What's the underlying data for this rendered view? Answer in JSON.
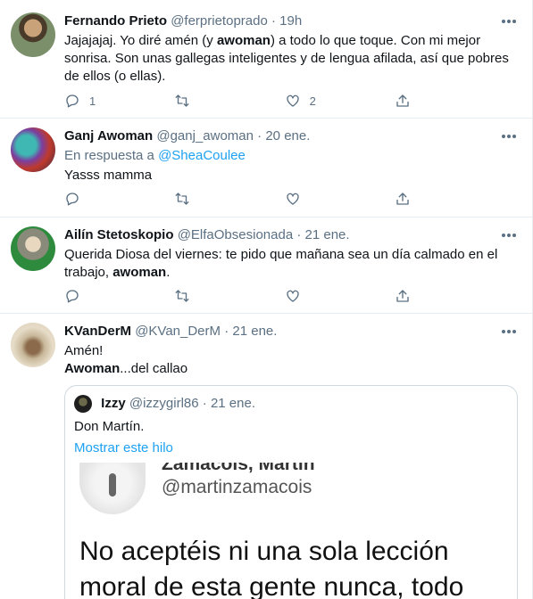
{
  "tweets": [
    {
      "name": "Fernando Prieto",
      "handle": "@ferprietoprado",
      "time": "19h",
      "text_parts": [
        "Jajajajaj. Yo diré amén (y ",
        "awoman",
        ") a todo lo que toque. Con mi mejor sonrisa. Son unas gallegas inteligentes y de lengua afilada, así que pobres de ellos (o ellas)."
      ],
      "reply_count": "1",
      "like_count": "2"
    },
    {
      "name": "Ganj Awoman",
      "handle": "@ganj_awoman",
      "time": "20 ene.",
      "reply_prefix": "En respuesta a",
      "reply_handle": "@SheaCoulee",
      "text": "Yasss mamma"
    },
    {
      "name": "Ailín Stetoskopio",
      "handle": "@ElfaObsesionada",
      "time": "21 ene.",
      "text_parts": [
        "Querida Diosa del viernes: te pido que mañana sea un día calmado en el trabajo, ",
        "awoman",
        "."
      ]
    },
    {
      "name": "KVanDerM",
      "handle": "@KVan_DerM",
      "time": "21 ene.",
      "line1": "Amén!",
      "line2_bold": "Awoman",
      "line2_rest": "...del callao",
      "quote": {
        "name": "Izzy",
        "handle": "@izzygirl86",
        "time": "21 ene.",
        "text": "Don Martín.",
        "link": "Mostrar este hilo",
        "image": {
          "name": "Zamacois, Martín",
          "handle": "@martinzamacois",
          "line1": "No aceptéis ni una sola lección",
          "line2": "moral de esta gente nunca, todo"
        }
      }
    }
  ],
  "dot": "·",
  "icons": [
    "reply-icon",
    "retweet-icon",
    "like-icon",
    "share-icon",
    "more-icon"
  ]
}
